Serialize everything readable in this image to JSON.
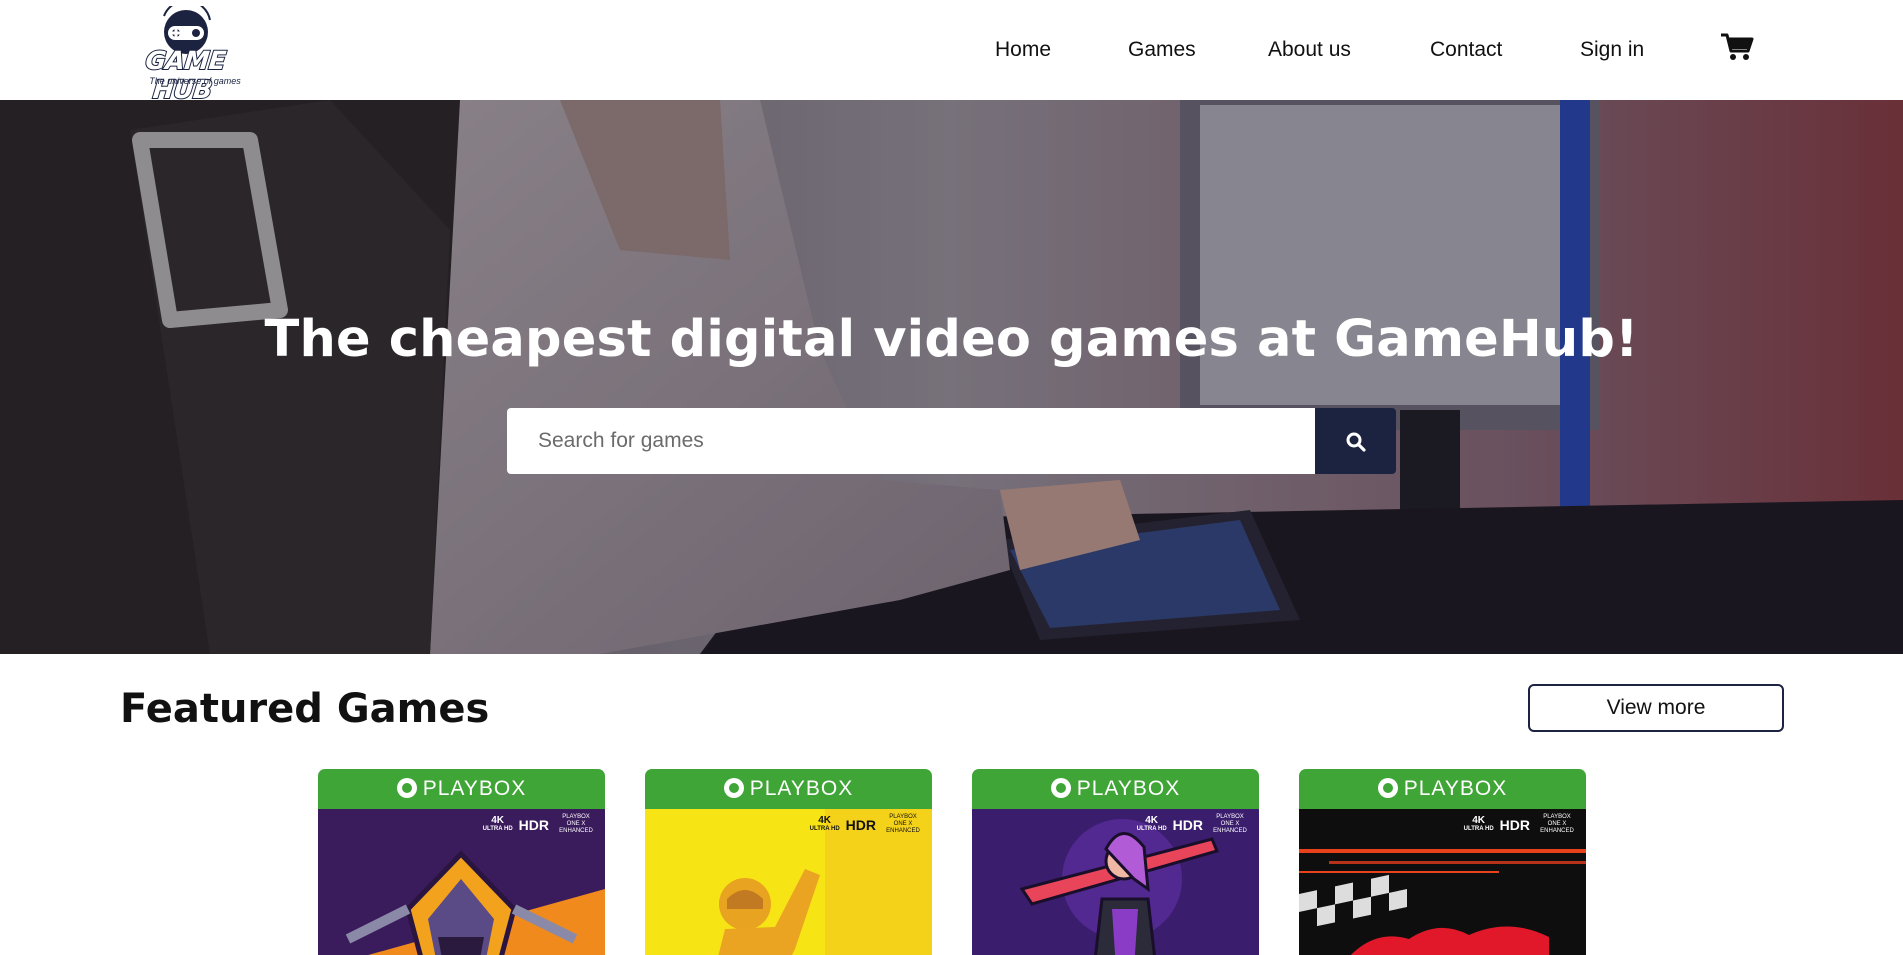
{
  "header": {
    "logo": {
      "name": "GAME HUB",
      "tagline": "The universe of games"
    },
    "nav": [
      {
        "label": "Home"
      },
      {
        "label": "Games"
      },
      {
        "label": "About us"
      },
      {
        "label": "Contact"
      },
      {
        "label": "Sign in"
      }
    ],
    "cart_icon": "shopping-cart-icon"
  },
  "hero": {
    "title": "The cheapest digital video games at GameHub!",
    "search": {
      "placeholder": "Search for games",
      "value": "",
      "button_icon": "search-icon"
    }
  },
  "featured": {
    "title": "Featured Games",
    "view_more_label": "View more",
    "cards": [
      {
        "brand": "PLAYBOX",
        "badge_4k": "4K",
        "badge_uhd": "ULTRA HD",
        "badge_hdr": "HDR",
        "badge_enh": "PLAYBOX ONE X ENHANCED",
        "art": "ninja-emblem"
      },
      {
        "brand": "PLAYBOX",
        "badge_4k": "4K",
        "badge_uhd": "ULTRA HD",
        "badge_hdr": "HDR",
        "badge_enh": "PLAYBOX ONE X ENHANCED",
        "art": "yellow-figure"
      },
      {
        "brand": "PLAYBOX",
        "badge_4k": "4K",
        "badge_uhd": "ULTRA HD",
        "badge_hdr": "HDR",
        "badge_enh": "PLAYBOX ONE X ENHANCED",
        "art": "sword-warrior"
      },
      {
        "brand": "PLAYBOX",
        "badge_4k": "4K",
        "badge_uhd": "ULTRA HD",
        "badge_hdr": "HDR",
        "badge_enh": "PLAYBOX ONE X ENHANCED",
        "art": "racing-flag"
      }
    ]
  },
  "colors": {
    "brand_navy": "#1c2340",
    "card_band_green": "#3fa536"
  }
}
